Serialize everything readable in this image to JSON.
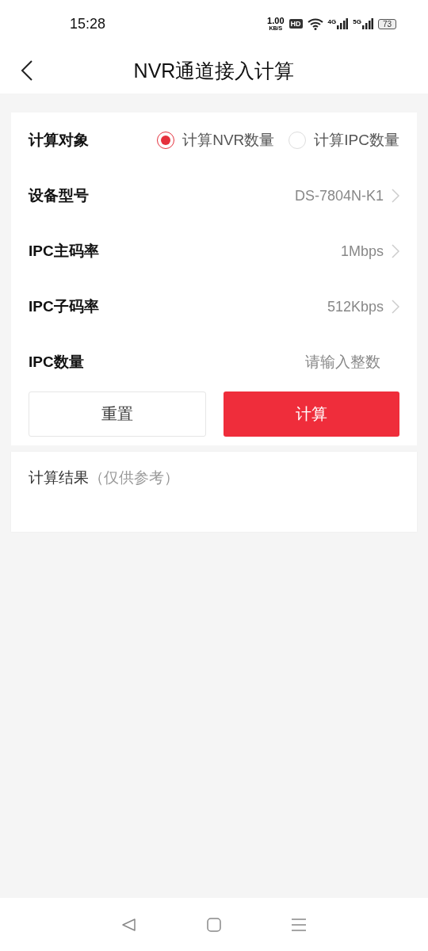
{
  "status_bar": {
    "time": "15:28",
    "speed": "1.00",
    "speed_unit": "KB/S",
    "hd": "HD",
    "networks": [
      "4G",
      "5G"
    ],
    "battery": "73"
  },
  "header": {
    "title": "NVR通道接入计算"
  },
  "form": {
    "rows": [
      {
        "kind": "radio",
        "label": "计算对象",
        "options": [
          {
            "label": "计算NVR数量",
            "selected": true
          },
          {
            "label": "计算IPC数量",
            "selected": false
          }
        ]
      },
      {
        "kind": "select",
        "label": "设备型号",
        "value": "DS-7804N-K1"
      },
      {
        "kind": "select",
        "label": "IPC主码率",
        "value": "1Mbps"
      },
      {
        "kind": "select",
        "label": "IPC子码率",
        "value": "512Kbps"
      },
      {
        "kind": "input",
        "label": "IPC数量",
        "placeholder": "请输入整数"
      }
    ],
    "buttons": [
      {
        "kind": "secondary",
        "label": "重置"
      },
      {
        "kind": "primary",
        "label": "计算"
      }
    ]
  },
  "result": {
    "title": "计算结果",
    "note": "（仅供参考）"
  }
}
